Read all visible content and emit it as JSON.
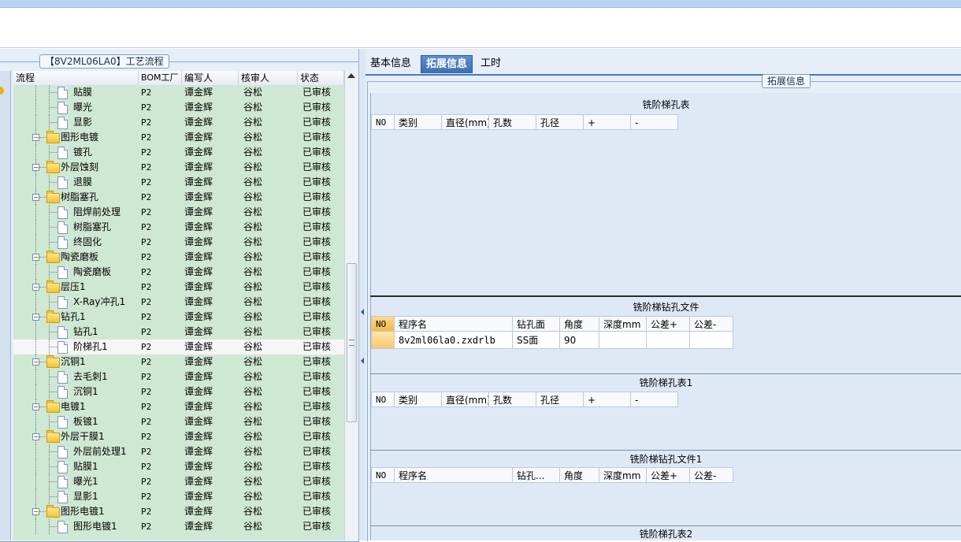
{
  "left": {
    "title": "【8V2ML06LA0】工艺流程",
    "columns": {
      "flow": "流程",
      "bom": "BOM工厂",
      "editor": "编写人",
      "reviewer": "核审人",
      "status": "状态"
    },
    "rows": [
      {
        "label": "贴膜",
        "level": 1,
        "kind": "doc",
        "bom": "P2",
        "editor": "谭金辉",
        "reviewer": "谷松",
        "status": "已审核"
      },
      {
        "label": "曝光",
        "level": 1,
        "kind": "doc",
        "bom": "P2",
        "editor": "谭金辉",
        "reviewer": "谷松",
        "status": "已审核"
      },
      {
        "label": "显影",
        "level": 1,
        "kind": "doc",
        "bom": "P2",
        "editor": "谭金辉",
        "reviewer": "谷松",
        "status": "已审核"
      },
      {
        "label": "图形电镀",
        "level": 0,
        "kind": "folder",
        "bom": "P2",
        "editor": "谭金辉",
        "reviewer": "谷松",
        "status": "已审核"
      },
      {
        "label": "镀孔",
        "level": 1,
        "kind": "doc",
        "bom": "P2",
        "editor": "谭金辉",
        "reviewer": "谷松",
        "status": "已审核"
      },
      {
        "label": "外层蚀刻",
        "level": 0,
        "kind": "folder",
        "bom": "P2",
        "editor": "谭金辉",
        "reviewer": "谷松",
        "status": "已审核"
      },
      {
        "label": "退膜",
        "level": 1,
        "kind": "doc",
        "bom": "P2",
        "editor": "谭金辉",
        "reviewer": "谷松",
        "status": "已审核"
      },
      {
        "label": "树脂塞孔",
        "level": 0,
        "kind": "folder",
        "bom": "P2",
        "editor": "谭金辉",
        "reviewer": "谷松",
        "status": "已审核"
      },
      {
        "label": "阻焊前处理",
        "level": 1,
        "kind": "doc",
        "bom": "P2",
        "editor": "谭金辉",
        "reviewer": "谷松",
        "status": "已审核"
      },
      {
        "label": "树脂塞孔",
        "level": 1,
        "kind": "doc",
        "bom": "P2",
        "editor": "谭金辉",
        "reviewer": "谷松",
        "status": "已审核"
      },
      {
        "label": "终固化",
        "level": 1,
        "kind": "doc",
        "bom": "P2",
        "editor": "谭金辉",
        "reviewer": "谷松",
        "status": "已审核"
      },
      {
        "label": "陶瓷磨板",
        "level": 0,
        "kind": "folder",
        "bom": "P2",
        "editor": "谭金辉",
        "reviewer": "谷松",
        "status": "已审核"
      },
      {
        "label": "陶瓷磨板",
        "level": 1,
        "kind": "doc",
        "bom": "P2",
        "editor": "谭金辉",
        "reviewer": "谷松",
        "status": "已审核"
      },
      {
        "label": "层压1",
        "level": 0,
        "kind": "folder",
        "bom": "P2",
        "editor": "谭金辉",
        "reviewer": "谷松",
        "status": "已审核"
      },
      {
        "label": "X-Ray冲孔1",
        "level": 1,
        "kind": "doc",
        "bom": "P2",
        "editor": "谭金辉",
        "reviewer": "谷松",
        "status": "已审核"
      },
      {
        "label": "钻孔1",
        "level": 0,
        "kind": "folder",
        "bom": "P2",
        "editor": "谭金辉",
        "reviewer": "谷松",
        "status": "已审核"
      },
      {
        "label": "钻孔1",
        "level": 1,
        "kind": "doc",
        "bom": "P2",
        "editor": "谭金辉",
        "reviewer": "谷松",
        "status": "已审核"
      },
      {
        "label": "阶梯孔1",
        "level": 1,
        "kind": "doc",
        "bom": "P2",
        "editor": "谭金辉",
        "reviewer": "谷松",
        "status": "已审核",
        "selected": true
      },
      {
        "label": "沉铜1",
        "level": 0,
        "kind": "folder",
        "bom": "P2",
        "editor": "谭金辉",
        "reviewer": "谷松",
        "status": "已审核"
      },
      {
        "label": "去毛刺1",
        "level": 1,
        "kind": "doc",
        "bom": "P2",
        "editor": "谭金辉",
        "reviewer": "谷松",
        "status": "已审核"
      },
      {
        "label": "沉铜1",
        "level": 1,
        "kind": "doc",
        "bom": "P2",
        "editor": "谭金辉",
        "reviewer": "谷松",
        "status": "已审核"
      },
      {
        "label": "电镀1",
        "level": 0,
        "kind": "folder",
        "bom": "P2",
        "editor": "谭金辉",
        "reviewer": "谷松",
        "status": "已审核"
      },
      {
        "label": "板镀1",
        "level": 1,
        "kind": "doc",
        "bom": "P2",
        "editor": "谭金辉",
        "reviewer": "谷松",
        "status": "已审核"
      },
      {
        "label": "外层干膜1",
        "level": 0,
        "kind": "folder",
        "bom": "P2",
        "editor": "谭金辉",
        "reviewer": "谷松",
        "status": "已审核"
      },
      {
        "label": "外层前处理1",
        "level": 1,
        "kind": "doc",
        "bom": "P2",
        "editor": "谭金辉",
        "reviewer": "谷松",
        "status": "已审核"
      },
      {
        "label": "贴膜1",
        "level": 1,
        "kind": "doc",
        "bom": "P2",
        "editor": "谭金辉",
        "reviewer": "谷松",
        "status": "已审核"
      },
      {
        "label": "曝光1",
        "level": 1,
        "kind": "doc",
        "bom": "P2",
        "editor": "谭金辉",
        "reviewer": "谷松",
        "status": "已审核"
      },
      {
        "label": "显影1",
        "level": 1,
        "kind": "doc",
        "bom": "P2",
        "editor": "谭金辉",
        "reviewer": "谷松",
        "status": "已审核"
      },
      {
        "label": "图形电镀1",
        "level": 0,
        "kind": "folder",
        "bom": "P2",
        "editor": "谭金辉",
        "reviewer": "谷松",
        "status": "已审核"
      },
      {
        "label": "图形电镀1",
        "level": 1,
        "kind": "doc",
        "bom": "P2",
        "editor": "谭金辉",
        "reviewer": "谷松",
        "status": "已审核"
      }
    ]
  },
  "tabs": [
    "基本信息",
    "拓展信息",
    "工时"
  ],
  "active_tab": "拓展信息",
  "right": {
    "group_title": "拓展信息",
    "sec1": {
      "title": "铣阶梯孔表",
      "cols": [
        "NO",
        "类别",
        "直径(mm)",
        "孔数",
        "孔径",
        "+",
        "-"
      ]
    },
    "sec2": {
      "title": "铣阶梯钻孔文件",
      "cols": [
        "NO",
        "程序名",
        "钻孔面",
        "角度",
        "深度mm",
        "公差+",
        "公差-"
      ],
      "row": [
        "",
        "8v2ml06la0.zxdrlb",
        "SS面",
        "90",
        "",
        "",
        ""
      ]
    },
    "sec3": {
      "title": "铣阶梯孔表1",
      "cols": [
        "NO",
        "类别",
        "直径(mm)",
        "孔数",
        "孔径",
        "+",
        "-"
      ]
    },
    "sec4": {
      "title": "铣阶梯钻孔文件1",
      "cols": [
        "NO",
        "程序名",
        "钻孔...",
        "角度",
        "深度mm",
        "公差+",
        "公差-"
      ]
    },
    "sec5": {
      "title": "铣阶梯孔表2"
    }
  },
  "colors": {
    "tree_bg": "#cfe8d3",
    "panel_bg": "#e6eef8",
    "tab_active": "#3c6eb4"
  },
  "icons": [
    "folder-icon",
    "document-icon",
    "scroll-up-arrow-icon",
    "splitter-arrow-icon"
  ]
}
